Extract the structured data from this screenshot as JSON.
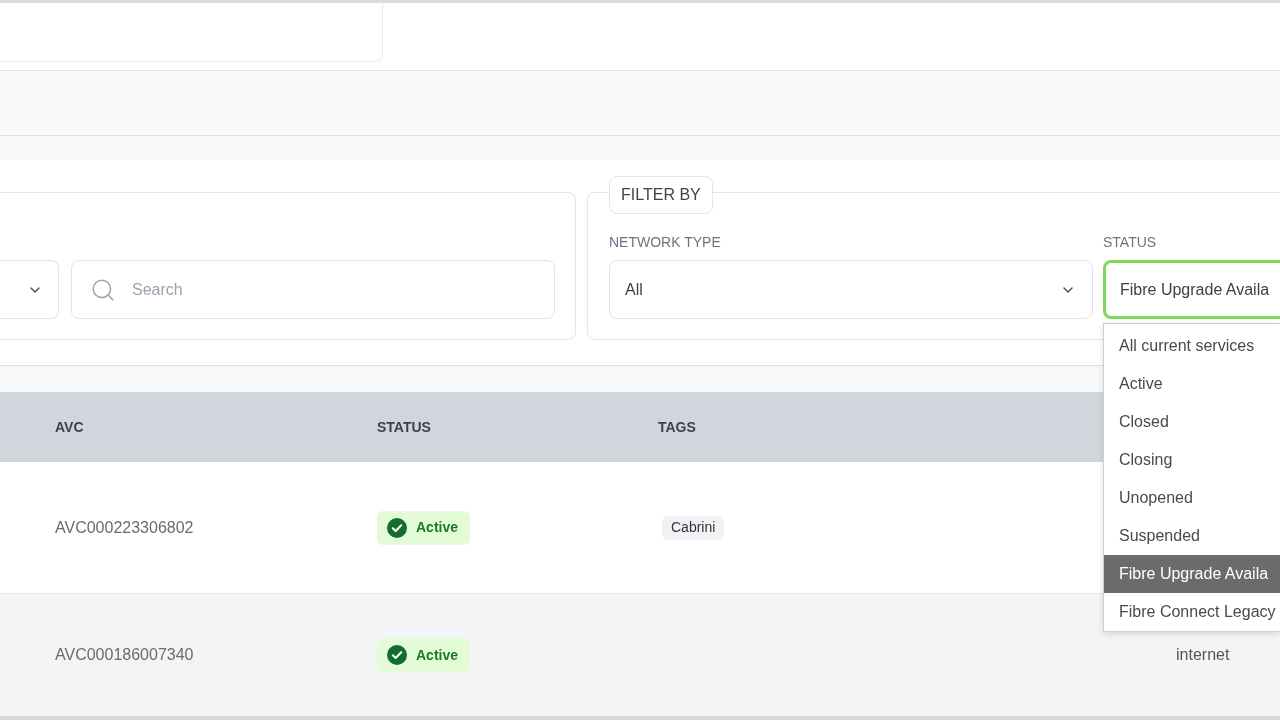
{
  "filters": {
    "search": {
      "placeholder": "Search"
    },
    "filter_by": {
      "legend": "FILTER BY",
      "network_type": {
        "label": "NETWORK TYPE",
        "value": "All"
      },
      "status": {
        "label": "STATUS",
        "value": "Fibre Upgrade Availa",
        "expanded": true,
        "options": [
          {
            "label": "All current services",
            "selected": false
          },
          {
            "label": "Active",
            "selected": false
          },
          {
            "label": "Closed",
            "selected": false
          },
          {
            "label": "Closing",
            "selected": false
          },
          {
            "label": "Unopened",
            "selected": false
          },
          {
            "label": "Suspended",
            "selected": false
          },
          {
            "label": "Fibre Upgrade Availa",
            "selected": true
          },
          {
            "label": "Fibre Connect Legacy",
            "selected": false
          }
        ]
      }
    }
  },
  "table": {
    "columns": [
      "AVC",
      "STATUS",
      "TAGS"
    ],
    "rows": [
      {
        "avc": "AVC000223306802",
        "status": "Active",
        "tags": [
          "Cabrini"
        ]
      },
      {
        "avc": "AVC000186007340",
        "status": "Active",
        "column_4": "internet"
      }
    ]
  }
}
